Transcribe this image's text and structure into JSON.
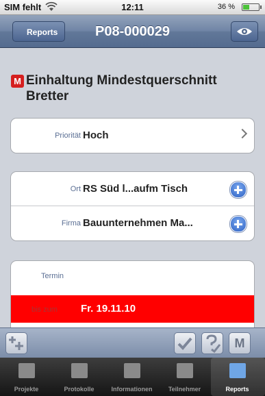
{
  "status_bar": {
    "carrier": "SIM fehlt",
    "time": "12:11",
    "battery": "36 %"
  },
  "nav": {
    "back_label": "Reports",
    "title": "P08-000029",
    "right_icon": "eye-icon"
  },
  "report": {
    "badge": "M",
    "title": "Einhaltung Mindestquerschnitt Bretter"
  },
  "priority": {
    "label": "Priorität",
    "value": "Hoch"
  },
  "location": {
    "ort_label": "Ort",
    "ort_value": "RS Süd l...aufm Tisch",
    "firma_label": "Firma",
    "firma_value": "Bauunternehmen Ma..."
  },
  "termin": {
    "label": "Termin",
    "due_label": "bis zum",
    "due_value": "Fr. 19.11.10",
    "highlight_color": "#ff0000"
  },
  "toolbar": {
    "m_label": "M"
  },
  "tabs": [
    {
      "label": "Projekte",
      "icon": "folder-icon"
    },
    {
      "label": "Protokolle",
      "icon": "protocol-icon"
    },
    {
      "label": "Informationen",
      "icon": "calendar-icon"
    },
    {
      "label": "Teilnehmer",
      "icon": "people-icon"
    },
    {
      "label": "Reports",
      "icon": "clipboard-icon",
      "active": true
    }
  ]
}
